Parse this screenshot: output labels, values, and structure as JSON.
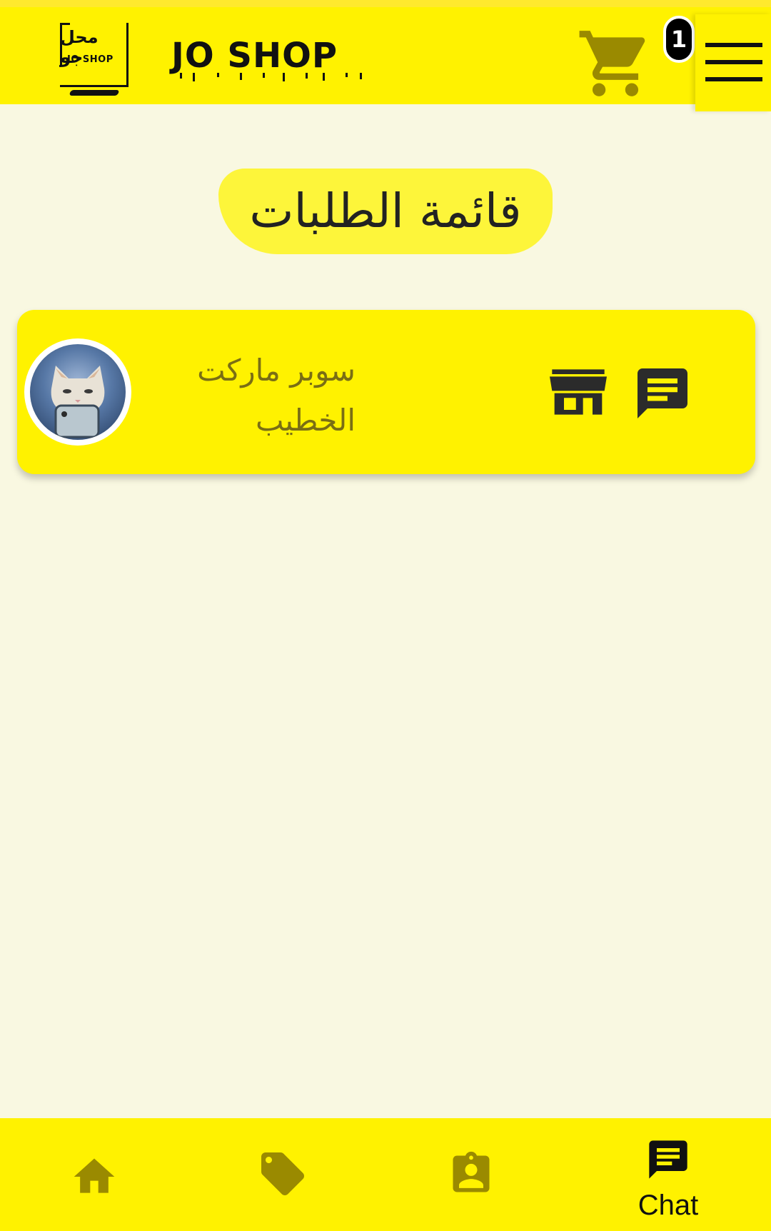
{
  "header": {
    "logo_ar": "محل جو",
    "logo_en": "JO SHOP",
    "brand": "JO SHOP",
    "cart_icon": "shopping-cart-icon",
    "cart_count": "1",
    "menu_icon": "hamburger-menu-icon"
  },
  "page": {
    "title": "قائمة الطلبات"
  },
  "orders": [
    {
      "store_name": "سوبر ماركت الخطيب",
      "avatar_icon": "cat-with-phone-avatar",
      "store_icon": "storefront-icon",
      "chat_icon": "chat-icon"
    }
  ],
  "bottom_nav": {
    "items": [
      {
        "icon": "home-icon",
        "label": ""
      },
      {
        "icon": "tag-icon",
        "label": ""
      },
      {
        "icon": "contact-badge-icon",
        "label": ""
      },
      {
        "icon": "chat-icon",
        "label": "Chat"
      }
    ],
    "active_index": 3
  },
  "colors": {
    "accent_yellow": "#fff200",
    "background": "#f9f8e1",
    "icon_olive": "#9a8a00",
    "icon_dark": "#2b2b2b"
  }
}
